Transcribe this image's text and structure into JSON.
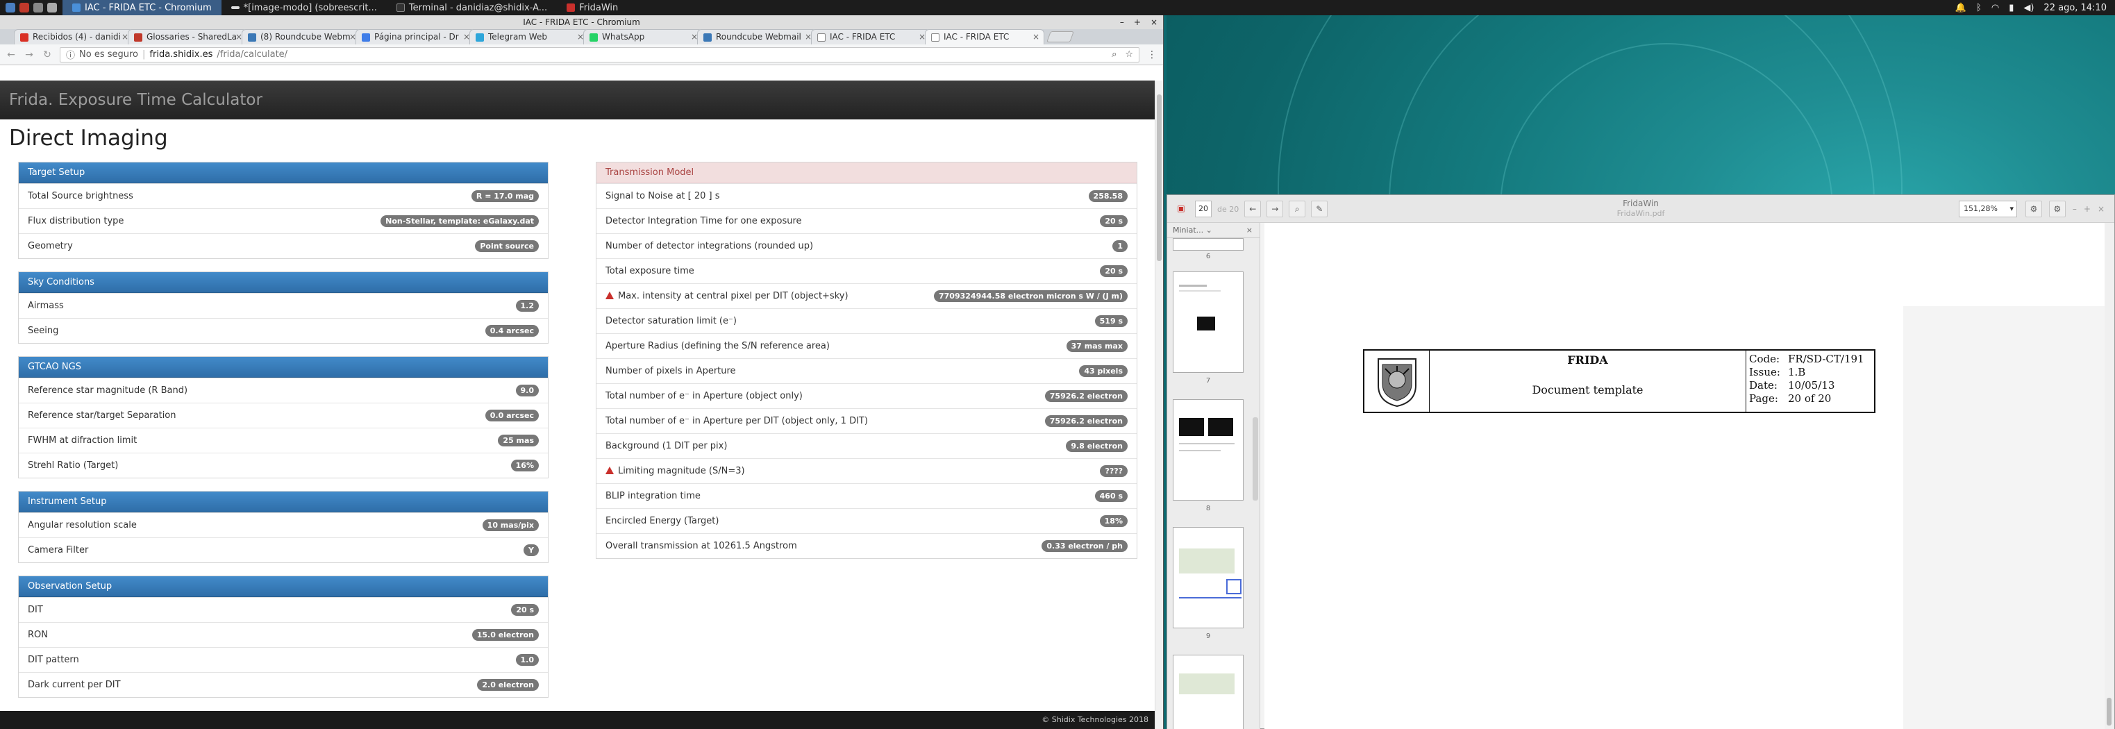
{
  "taskbar": {
    "tasks": [
      {
        "label": "IAC - FRIDA ETC - Chromium",
        "active": true
      },
      {
        "label": "*[image-modo] (sobreescrit..."
      },
      {
        "label": "Terminal - danidiaz@shidix-A..."
      },
      {
        "label": "FridaWin"
      }
    ],
    "datetime": "22 ago, 14:10"
  },
  "browser": {
    "window_title": "IAC - FRIDA ETC - Chromium",
    "tabs": [
      {
        "label": "Recibidos (4) - danidi",
        "color": "#d93025"
      },
      {
        "label": "Glossaries - SharedLa",
        "color": "#c0392b"
      },
      {
        "label": "(8) Roundcube Webm",
        "color": "#3b78b6"
      },
      {
        "label": "Página principal - Dr",
        "color": "#3f7de8"
      },
      {
        "label": "Telegram Web",
        "color": "#2ea6da"
      },
      {
        "label": "WhatsApp",
        "color": "#25d366"
      },
      {
        "label": "Roundcube Webmail",
        "color": "#3b78b6"
      },
      {
        "label": "IAC - FRIDA ETC",
        "color": "#888888"
      },
      {
        "label": "IAC - FRIDA ETC",
        "color": "#888888",
        "active": true
      }
    ],
    "security_label": "No es seguro",
    "url_host": "frida.shidix.es",
    "url_path": "/frida/calculate/"
  },
  "page": {
    "brand": "Frida. Exposure Time Calculator",
    "heading": "Direct Imaging",
    "footer": "© Shidix Technologies 2018",
    "left_panels": [
      {
        "title": "Target Setup",
        "rows": [
          {
            "label": "Total Source brightness",
            "value": "R = 17.0 mag"
          },
          {
            "label": "Flux distribution type",
            "value": "Non-Stellar, template: eGalaxy.dat"
          },
          {
            "label": "Geometry",
            "value": "Point source"
          }
        ]
      },
      {
        "title": "Sky Conditions",
        "rows": [
          {
            "label": "Airmass",
            "value": "1.2"
          },
          {
            "label": "Seeing",
            "value": "0.4 arcsec"
          }
        ]
      },
      {
        "title": "GTCAO NGS",
        "rows": [
          {
            "label": "Reference star magnitude (R Band)",
            "value": "9.0"
          },
          {
            "label": "Reference star/target Separation",
            "value": "0.0 arcsec"
          },
          {
            "label": "FWHM at difraction limit",
            "value": "25 mas"
          },
          {
            "label": "Strehl Ratio (Target)",
            "value": "16%"
          }
        ]
      },
      {
        "title": "Instrument Setup",
        "rows": [
          {
            "label": "Angular resolution scale",
            "value": "10 mas/pix"
          },
          {
            "label": "Camera Filter",
            "value": "Y"
          }
        ]
      },
      {
        "title": "Observation Setup",
        "rows": [
          {
            "label": "DIT",
            "value": "20 s"
          },
          {
            "label": "RON",
            "value": "15.0 electron"
          },
          {
            "label": "DIT pattern",
            "value": "1.0"
          },
          {
            "label": "Dark current per DIT",
            "value": "2.0 electron"
          }
        ]
      }
    ],
    "transmission": {
      "title": "Transmission Model",
      "rows": [
        {
          "label": "Signal to Noise at [ 20 ] s",
          "value": "258.58"
        },
        {
          "label": "Detector Integration Time for one exposure",
          "value": "20 s"
        },
        {
          "label": "Number of detector integrations (rounded up)",
          "value": "1"
        },
        {
          "label": "Total exposure time",
          "value": "20 s"
        },
        {
          "label": "Max. intensity at central pixel per DIT (object+sky)",
          "value": "7709324944.58 electron micron s W / (J m)",
          "warning": true
        },
        {
          "label": "Detector saturation limit (e⁻)",
          "value": "519 s"
        },
        {
          "label": "Aperture Radius (defining the S/N reference area)",
          "value": "37 mas max"
        },
        {
          "label": "Number of pixels in Aperture",
          "value": "43 pixels"
        },
        {
          "label": "Total number of e⁻ in Aperture (object only)",
          "value": "75926.2 electron"
        },
        {
          "label": "Total number of e⁻ in Aperture per DIT (object only, 1 DIT)",
          "value": "75926.2 electron"
        },
        {
          "label": "Background (1 DIT per pix)",
          "value": "9.8 electron"
        },
        {
          "label": "Limiting magnitude (S/N=3)",
          "value": "????",
          "warning": true
        },
        {
          "label": "BLIP integration time",
          "value": "460 s"
        },
        {
          "label": "Encircled Energy (Target)",
          "value": "18%"
        },
        {
          "label": "Overall transmission at 10261.5 Angstrom",
          "value": "0.33 electron / ph"
        }
      ]
    }
  },
  "fridawin": {
    "title": "FridaWin",
    "file": "FridaWin.pdf",
    "page_number": "20",
    "page_of": "de 20",
    "zoom": "151,28%",
    "sidebar_title": "Miniat...",
    "thumb_pages": [
      "6",
      "7",
      "8",
      "9"
    ],
    "doc_title": "FRIDA",
    "doc_subtitle": "Document template",
    "doc_meta": [
      {
        "key": "Code:",
        "value": "FR/SD-CT/191"
      },
      {
        "key": "Issue:",
        "value": "1.B"
      },
      {
        "key": "Date:",
        "value": "10/05/13"
      },
      {
        "key": "Page:",
        "value": "20 of 20"
      }
    ]
  }
}
